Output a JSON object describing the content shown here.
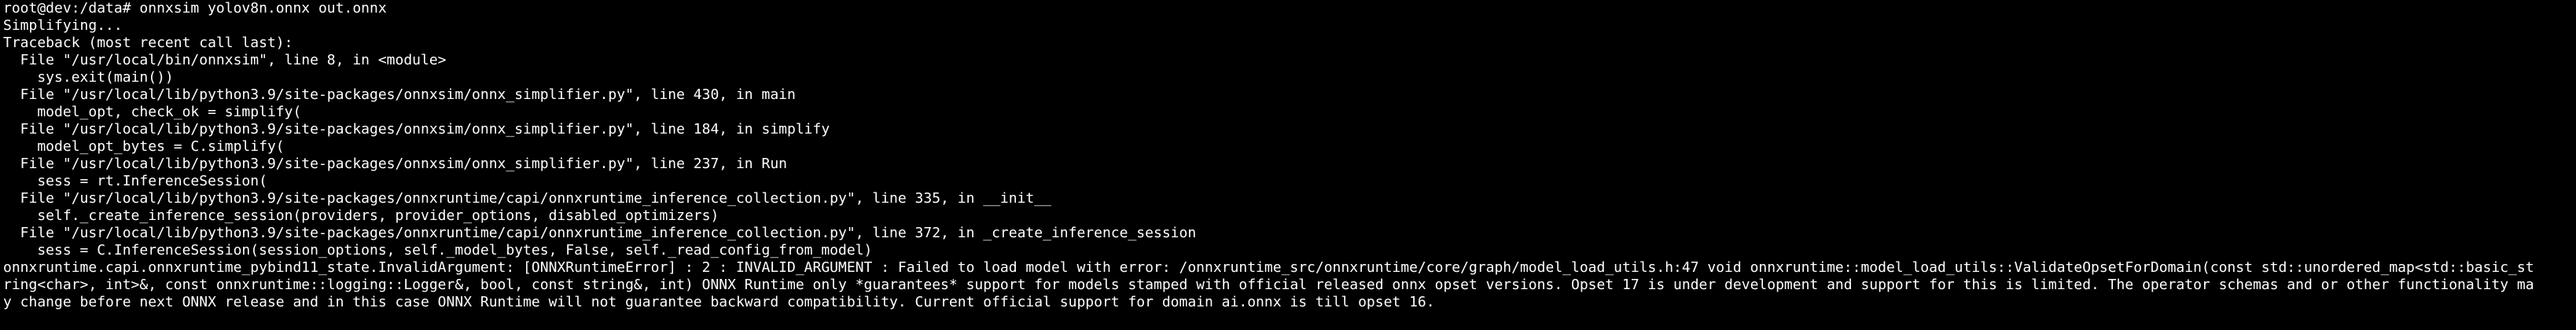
{
  "terminal": {
    "lines": [
      "root@dev:/data# onnxsim yolov8n.onnx out.onnx",
      "Simplifying...",
      "Traceback (most recent call last):",
      "  File \"/usr/local/bin/onnxsim\", line 8, in <module>",
      "    sys.exit(main())",
      "  File \"/usr/local/lib/python3.9/site-packages/onnxsim/onnx_simplifier.py\", line 430, in main",
      "    model_opt, check_ok = simplify(",
      "  File \"/usr/local/lib/python3.9/site-packages/onnxsim/onnx_simplifier.py\", line 184, in simplify",
      "    model_opt_bytes = C.simplify(",
      "  File \"/usr/local/lib/python3.9/site-packages/onnxsim/onnx_simplifier.py\", line 237, in Run",
      "    sess = rt.InferenceSession(",
      "  File \"/usr/local/lib/python3.9/site-packages/onnxruntime/capi/onnxruntime_inference_collection.py\", line 335, in __init__",
      "    self._create_inference_session(providers, provider_options, disabled_optimizers)",
      "  File \"/usr/local/lib/python3.9/site-packages/onnxruntime/capi/onnxruntime_inference_collection.py\", line 372, in _create_inference_session",
      "    sess = C.InferenceSession(session_options, self._model_bytes, False, self._read_config_from_model)",
      "onnxruntime.capi.onnxruntime_pybind11_state.InvalidArgument: [ONNXRuntimeError] : 2 : INVALID_ARGUMENT : Failed to load model with error: /onnxruntime_src/onnxruntime/core/graph/model_load_utils.h:47 void onnxruntime::model_load_utils::ValidateOpsetForDomain(const std::unordered_map<std::basic_st",
      "ring<char>, int>&, const onnxruntime::logging::Logger&, bool, const string&, int) ONNX Runtime only *guarantees* support for models stamped with official released onnx opset versions. Opset 17 is under development and support for this is limited. The operator schemas and or other functionality ma",
      "y change before next ONNX release and in this case ONNX Runtime will not guarantee backward compatibility. Current official support for domain ai.onnx is till opset 16."
    ]
  }
}
